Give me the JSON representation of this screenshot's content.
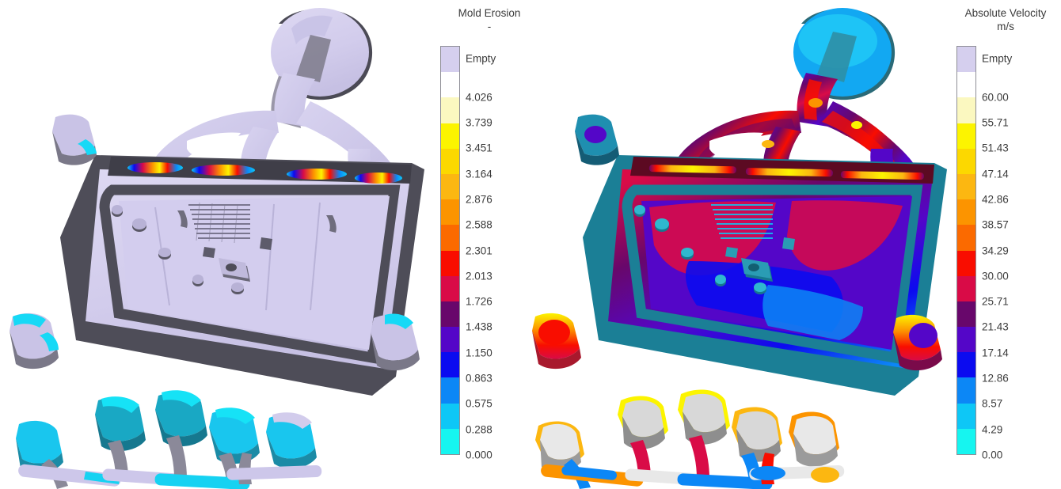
{
  "scene": {
    "background_color": "#ffffff",
    "empty_color": "#d5cfee"
  },
  "colorbar_palette": [
    "#d5cfee",
    "#ffffff",
    "#fbf8c0",
    "#fcf400",
    "#fcd800",
    "#fcb711",
    "#fc9400",
    "#fb6a00",
    "#f90d00",
    "#d90b47",
    "#68076b",
    "#5406c8",
    "#0b0bf0",
    "#0c87f6",
    "#0ec7f6",
    "#16f5f0"
  ],
  "legends": [
    {
      "id": "mold-erosion",
      "title": "Mold Erosion",
      "units": "-",
      "top_label": "Empty",
      "tick_labels": [
        "4.026",
        "3.739",
        "3.451",
        "3.164",
        "2.876",
        "2.588",
        "2.301",
        "2.013",
        "1.726",
        "1.438",
        "1.150",
        "0.863",
        "0.575",
        "0.288",
        "0.000"
      ],
      "range_min": 0.0,
      "range_max": 4.026
    },
    {
      "id": "velocity",
      "title": "Absolute Velocity",
      "units": "m/s",
      "top_label": "Empty",
      "tick_labels": [
        "60.00",
        "55.71",
        "51.43",
        "47.14",
        "42.86",
        "38.57",
        "34.29",
        "30.00",
        "25.71",
        "21.43",
        "17.14",
        "12.86",
        "8.57",
        "4.29",
        "0.00"
      ],
      "range_min": 0.0,
      "range_max": 60.0
    }
  ],
  "views": [
    {
      "id": "mold-erosion",
      "name": "mold-erosion-view",
      "description": "Die casting part with runner and biscuit shown mostly unfilled (Empty lavender) with localized erosion hot spots along the inner gate and on the overflow blocks."
    },
    {
      "id": "velocity",
      "name": "absolute-velocity-view",
      "description": "Same die casting geometry colored by absolute velocity magnitude, with high velocity jets at the gates and overflows."
    }
  ]
}
